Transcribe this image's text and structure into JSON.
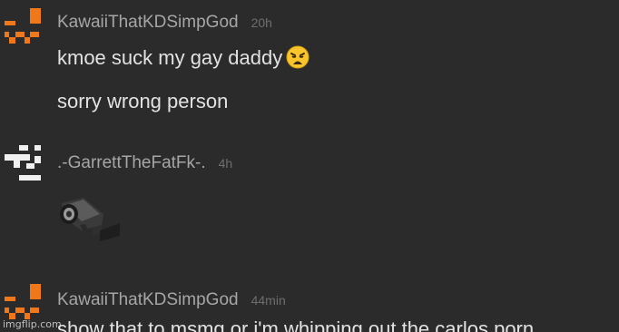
{
  "messages": [
    {
      "username": "KawaiiThatKDSimpGod",
      "time": "20h",
      "avatar_color": "#f07818",
      "lines": [
        {
          "text": "kmoe suck my gay daddy",
          "emoji": "weary-face-emoji"
        },
        {
          "text": "sorry wrong person"
        }
      ]
    },
    {
      "username": ".-GarrettTheFatFk-.",
      "time": "4h",
      "avatar_color": "#f0f0f0",
      "attachment": "security-camera-image"
    },
    {
      "username": "KawaiiThatKDSimpGod",
      "time": "44min",
      "avatar_color": "#f07818",
      "lines": [
        {
          "text": "show that to msmg or i'm whipping out the carlos porn"
        }
      ]
    }
  ],
  "watermark": "imgflip.com",
  "colors": {
    "background": "#2b2b2b",
    "username": "#a6a6a6",
    "timestamp": "#6e6e6e",
    "message_text": "#e2e2e2"
  }
}
